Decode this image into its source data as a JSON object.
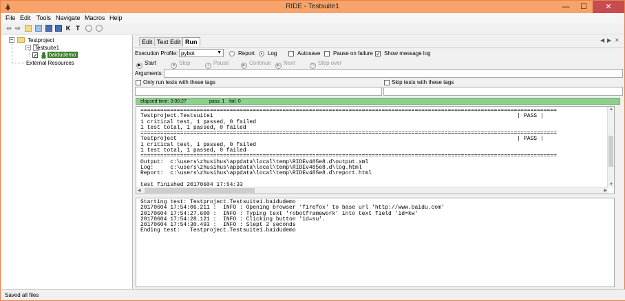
{
  "window": {
    "title": "RIDE - Testsuite1",
    "minimize": "—",
    "maximize": "☐",
    "close": "✕"
  },
  "menu": [
    "File",
    "Edit",
    "Tools",
    "Navigate",
    "Macros",
    "Help"
  ],
  "toolbar_icons": [
    "back-arrow-icon",
    "forward-arrow-icon",
    "open-folder-icon",
    "open-directory-icon",
    "save-icon",
    "save-all-icon",
    "keyword-search-icon",
    "test-tag-icon",
    "run-icon",
    "stop-icon"
  ],
  "tree": {
    "root": "Testproject",
    "suite": "Testsuite1",
    "test": "baidudemo",
    "external": "External Resources"
  },
  "tabs": [
    "Edit",
    "Text Edit",
    "Run"
  ],
  "active_tab": "Run",
  "run": {
    "profile_label": "Execution Profile:",
    "profile_value": "pybot",
    "report_label": "Report",
    "log_label": "Log",
    "autosave_label": "Autosave",
    "pause_failure_label": "Pause on failure",
    "show_message_log_label": "Show message log",
    "buttons": {
      "start": "Start",
      "stop": "Stop",
      "pause": "Pause",
      "continue": "Continue",
      "next": "Next",
      "step_over": "Step over"
    },
    "arguments_label": "Arguments:",
    "only_run_tags_label": "Only run tests with these tags",
    "skip_tags_label": "Skip tests with these tags",
    "elapsed": "elapsed time: 0:00:27",
    "pass": "pass: 1",
    "fail": "fail: 0"
  },
  "console_output": "==============================================================================================================================\nTestproject.Testsuite1                                                                                            | PASS |\n1 critical test, 1 passed, 0 failed\n1 test total, 1 passed, 0 failed\n==============================================================================================================================\nTestproject                                                                                                       | PASS |\n1 critical test, 1 passed, 0 failed\n1 test total, 1 passed, 0 failed\n==============================================================================================================================\nOutput:  c:\\users\\zhusihus\\appdata\\local\\temp\\RIDEv485e8.d\\output.xml\nLog:     c:\\users\\zhusihus\\appdata\\local\\temp\\RIDEv485e8.d\\log.html\nReport:  c:\\users\\zhusihus\\appdata\\local\\temp\\RIDEv485e8.d\\report.html\n\ntest finished 20170604 17:54:33",
  "message_log": "Starting test: Testproject.Testsuite1.baidudemo\n20170604 17:54:06.211 :  INFO : Opening browser 'firefox' to base url 'http://www.baidu.com'\n20170604 17:54:27.600 :  INFO : Typing text 'robotframework' into text field 'id=kw'\n20170604 17:54:28.121 :  INFO : Clicking button 'id=su'.\n20170604 17:54:30.493 :  INFO : Slept 2 seconds\nEnding test:   Testproject.Testsuite1.baidudemo",
  "status_text": "Saved all files",
  "colors": {
    "titlebar": "#f7a36a",
    "close": "#c74b50",
    "progress": "#8fd08f",
    "selected": "#3a7d2a"
  }
}
